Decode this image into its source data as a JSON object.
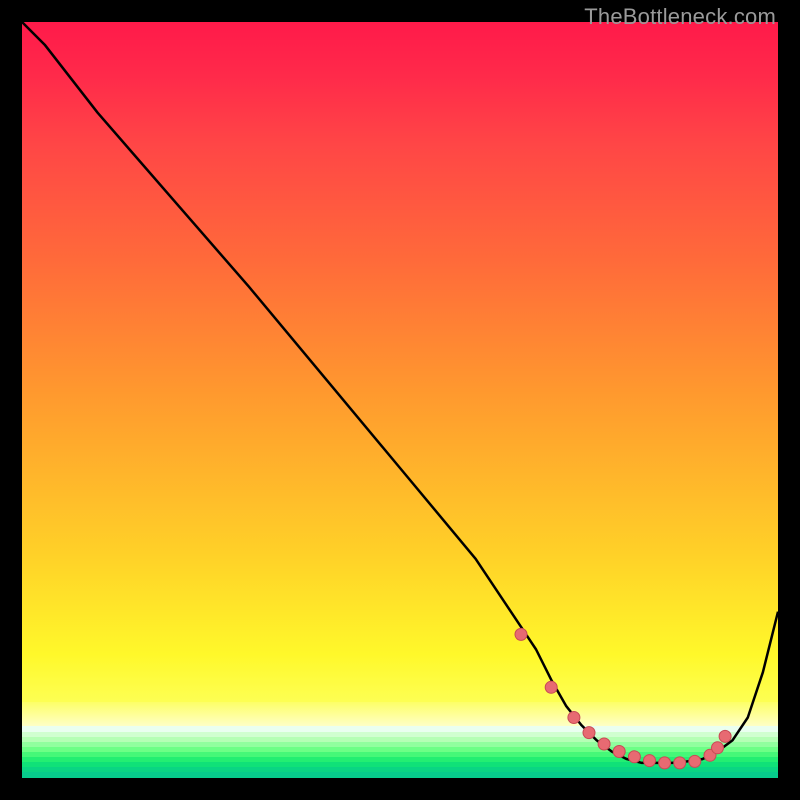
{
  "watermark": {
    "text": "TheBottleneck.com"
  },
  "colors": {
    "gradient_top": "#ff1a4a",
    "gradient_mid": "#ffd028",
    "gradient_low": "#fdff53",
    "pale_yellow": "#feffc6",
    "green_light": "#b6ff9e",
    "green_mid": "#5cff76",
    "green_deep": "#16e36a",
    "green_teal": "#0ccf87",
    "curve_stroke": "#000000",
    "marker_fill": "#e76a72",
    "marker_stroke": "#c84a55"
  },
  "chart_data": {
    "type": "line",
    "title": "",
    "xlabel": "",
    "ylabel": "",
    "xlim": [
      0,
      100
    ],
    "ylim": [
      0,
      100
    ],
    "legend": false,
    "grid": false,
    "background": "vertical thermal gradient (red→yellow→green)",
    "series": [
      {
        "name": "bottleneck-curve",
        "x": [
          0,
          3,
          10,
          20,
          30,
          40,
          50,
          60,
          64,
          66,
          68,
          70,
          72,
          74,
          76,
          78,
          80,
          82,
          84,
          86,
          88,
          90,
          92,
          94,
          96,
          98,
          100
        ],
        "y": [
          100,
          97,
          88,
          76.5,
          65,
          53,
          41,
          29,
          23,
          20,
          17,
          13,
          9.5,
          7,
          5,
          3.5,
          2.5,
          2,
          2,
          2,
          2.2,
          2.5,
          3.5,
          5,
          8,
          14,
          22
        ],
        "note": "y read as height above bottom border, percent of plot height; curve descends from top-left, flattens in a valley ~x 78–90, rises again near right edge"
      }
    ],
    "markers": {
      "name": "valley-points",
      "style": "filled-circle",
      "x": [
        66,
        70,
        73,
        75,
        77,
        79,
        81,
        83,
        85,
        87,
        89,
        91,
        92,
        93
      ],
      "y": [
        19,
        12,
        8,
        6,
        4.5,
        3.5,
        2.8,
        2.3,
        2,
        2,
        2.2,
        3,
        4,
        5.5
      ]
    }
  }
}
